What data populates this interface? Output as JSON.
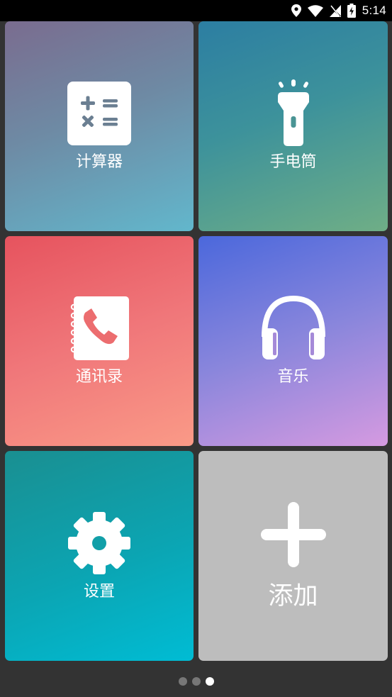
{
  "status_bar": {
    "time": "5:14",
    "icons": [
      "location-icon",
      "wifi-icon",
      "no-sim-icon",
      "battery-charging-icon"
    ]
  },
  "tiles": [
    {
      "label": "计算器",
      "icon": "calculator-icon",
      "colors": [
        "#7a6c8f",
        "#62b7cc"
      ]
    },
    {
      "label": "手电筒",
      "icon": "flashlight-icon",
      "colors": [
        "#2c7ea2",
        "#6fae86"
      ]
    },
    {
      "label": "通讯录",
      "icon": "contacts-icon",
      "colors": [
        "#e6535e",
        "#fa9a87"
      ]
    },
    {
      "label": "音乐",
      "icon": "headphones-icon",
      "colors": [
        "#4b68dc",
        "#d59ae0"
      ]
    },
    {
      "label": "设置",
      "icon": "gear-icon",
      "colors": [
        "#1a8f91",
        "#00bcd4"
      ]
    },
    {
      "label": "添加",
      "icon": "plus-icon",
      "colors": [
        "#bdbdbd"
      ]
    }
  ],
  "pager": {
    "pages": 3,
    "current_page": 3,
    "dot_colors": {
      "inactive": "#777777",
      "active": "#ffffff"
    }
  }
}
